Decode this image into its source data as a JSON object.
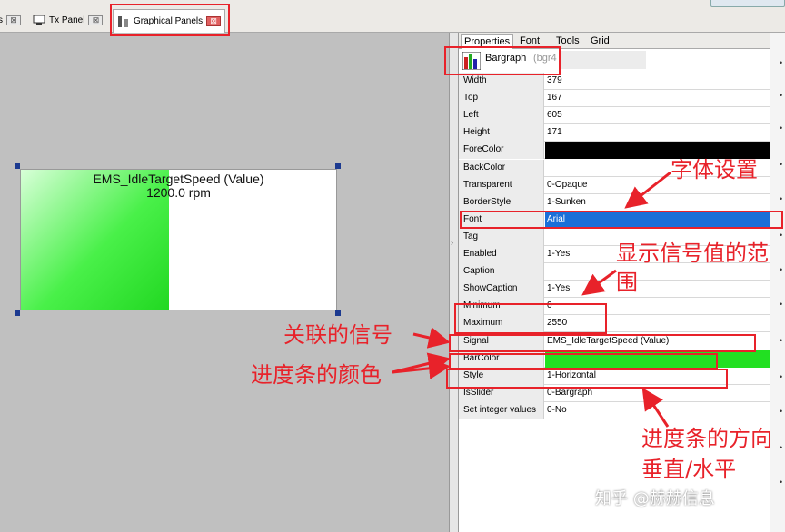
{
  "tabs": [
    {
      "label": "s",
      "close": "⊠"
    },
    {
      "label": "Tx Panel",
      "close": "⊠"
    },
    {
      "label": "Graphical Panels",
      "close": "⊠"
    }
  ],
  "canvas": {
    "bargraph": {
      "caption_line1": "EMS_IdleTargetSpeed (Value)",
      "caption_line2": "1200.0 rpm",
      "fill_fraction": 0.47,
      "bar_color": "#22e022"
    }
  },
  "properties": {
    "tabs": [
      "Properties",
      "Font",
      "Tools",
      "Grid"
    ],
    "object_name": "Bargraph",
    "object_id": "(bgr4",
    "rows": [
      {
        "name": "Width",
        "value": "379"
      },
      {
        "name": "Top",
        "value": "167"
      },
      {
        "name": "Left",
        "value": "605"
      },
      {
        "name": "Height",
        "value": "171"
      },
      {
        "name": "ForeColor",
        "value": ""
      },
      {
        "name": "BackColor",
        "value": ""
      },
      {
        "name": "Transparent",
        "value": "0-Opaque"
      },
      {
        "name": "BorderStyle",
        "value": "1-Sunken"
      },
      {
        "name": "Font",
        "value": "Arial"
      },
      {
        "name": "Tag",
        "value": ""
      },
      {
        "name": "Enabled",
        "value": "1-Yes"
      },
      {
        "name": "Caption",
        "value": ""
      },
      {
        "name": "ShowCaption",
        "value": "1-Yes"
      },
      {
        "name": "Minimum",
        "value": "0"
      },
      {
        "name": "Maximum",
        "value": "2550"
      },
      {
        "name": "Signal",
        "value": "EMS_IdleTargetSpeed (Value)"
      },
      {
        "name": "BarColor",
        "value": ""
      },
      {
        "name": "Style",
        "value": "1-Horizontal"
      },
      {
        "name": "IsSlider",
        "value": "0-Bargraph"
      },
      {
        "name": "Set integer values",
        "value": "0-No"
      }
    ]
  },
  "annotations": {
    "font_setting": "字体设置",
    "range_line1": "显示信号值的范",
    "range_line2": "围",
    "signal": "关联的信号",
    "bar_color": "进度条的颜色",
    "direction_line1": "进度条的方向",
    "direction_line2": "垂直/水平"
  },
  "watermark": "知乎 @赫赫信息",
  "colors": {
    "annotation_red": "#e8222a",
    "fore_color": "#000000",
    "font_highlight": "#1a6fd8",
    "bar_color": "#22e022"
  }
}
